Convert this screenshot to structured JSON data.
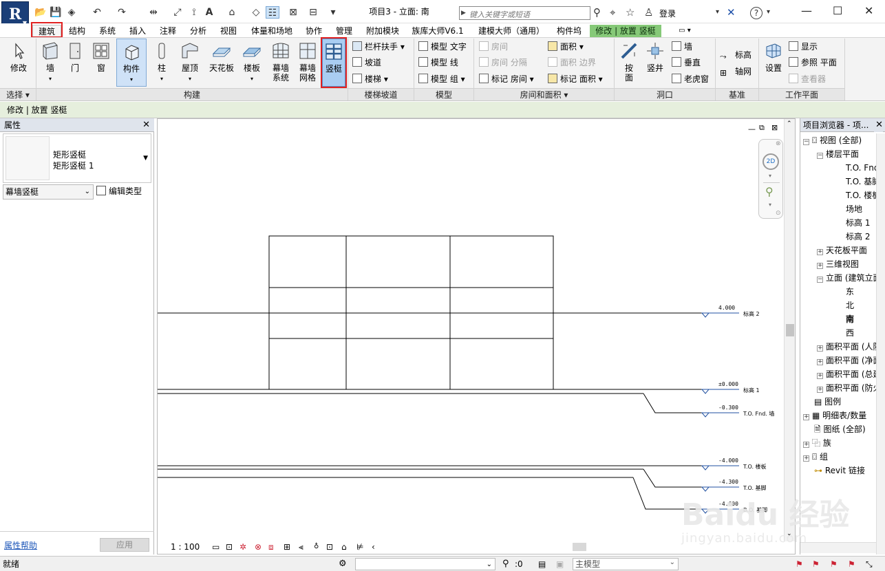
{
  "title": "项目3 - 立面: 南",
  "search_placeholder": "键入关键字或短语",
  "login": "登录",
  "tabs": [
    "建筑",
    "结构",
    "系统",
    "插入",
    "注释",
    "分析",
    "视图",
    "体量和场地",
    "协作",
    "管理",
    "附加模块",
    "族库大师V6.1",
    "建模大师（通用）",
    "构件坞",
    "修改 | 放置 竖梃"
  ],
  "ribbon": {
    "select": {
      "modify": "修改",
      "label": "选择"
    },
    "build": {
      "label": "构建",
      "buttons": [
        "墙",
        "门",
        "窗",
        "构件",
        "柱",
        "屋顶",
        "天花板",
        "楼板",
        "幕墙\n系统",
        "幕墙\n网格",
        "竖梃"
      ],
      "wall": "墙",
      "door": "门",
      "window": "窗",
      "component": "构件",
      "column": "柱",
      "roof": "屋顶",
      "ceiling": "天花板",
      "floor": "楼板",
      "curtain_system": "幕墙",
      "curtain_system2": "系统",
      "curtain_grid": "幕墙",
      "curtain_grid2": "网格",
      "mullion": "竖梃"
    },
    "stairs": {
      "label": "楼梯坡道",
      "railing": "栏杆扶手",
      "ramp": "坡道",
      "stair": "楼梯"
    },
    "model": {
      "label": "模型",
      "text": "模型 文字",
      "line": "模型 线",
      "group": "模型 组"
    },
    "room": {
      "label": "房间和面积",
      "room": "房间",
      "room_sep": "房间 分隔",
      "tag_room": "标记 房间",
      "area": "面积",
      "area_boundary": "面积 边界",
      "tag_area": "标记 面积"
    },
    "opening": {
      "label": "洞口",
      "by_face": "按",
      "by_face2": "面",
      "shaft": "竖井",
      "wall": "墙",
      "vertical": "垂直",
      "dormer": "老虎窗"
    },
    "datum": {
      "label": "基准",
      "level": "标高",
      "grid": "轴网"
    },
    "workplane": {
      "label": "工作平面",
      "set": "设置",
      "show": "显示",
      "ref": "参照 平面",
      "viewer": "查看器"
    }
  },
  "options_bar": "修改 | 放置 竖梃",
  "properties": {
    "header": "属性",
    "type_line1": "矩形竖梃",
    "type_line2": "矩形竖梃 1",
    "instance": "幕墙竖梃",
    "edit_type": "编辑类型",
    "help": "属性帮助",
    "apply": "应用"
  },
  "view": {
    "scale": "1 : 100",
    "levels": [
      {
        "elev": "4.000",
        "name": "标高 2"
      },
      {
        "elev": "±0.000",
        "name": "标高 1"
      },
      {
        "elev": "-0.300",
        "name": "T.O. Fnd. 墙"
      },
      {
        "elev": "-4.000",
        "name": "T.O. 楼板"
      },
      {
        "elev": "-4.300",
        "name": "T.O. 基脚"
      },
      {
        "elev": "-4.600",
        "name": "B.O. 基脚"
      }
    ]
  },
  "browser": {
    "header": "项目浏览器 - 项...",
    "views": "视图 (全部)",
    "floor_plans": "楼层平面",
    "floor_items": [
      "T.O. Fnd.",
      "T.O. 基脚",
      "T.O. 楼板",
      "场地",
      "标高 1",
      "标高 2"
    ],
    "ceiling": "天花板平面",
    "threed": "三维视图",
    "elevations": "立面 (建筑立面",
    "elev_items": [
      "东",
      "北",
      "南",
      "西"
    ],
    "area_plans": [
      "面积平面 (人防",
      "面积平面 (净面",
      "面积平面 (总建",
      "面积平面 (防火"
    ],
    "legends": "图例",
    "schedules": "明细表/数量",
    "sheets": "图纸 (全部)",
    "families": "族",
    "groups": "组",
    "links": "Revit 链接"
  },
  "status": {
    "ready": "就绪",
    "count": ":0",
    "model": "主模型"
  },
  "watermark": "Baidu 经验",
  "watermark2": "jingyan.baidu.com"
}
